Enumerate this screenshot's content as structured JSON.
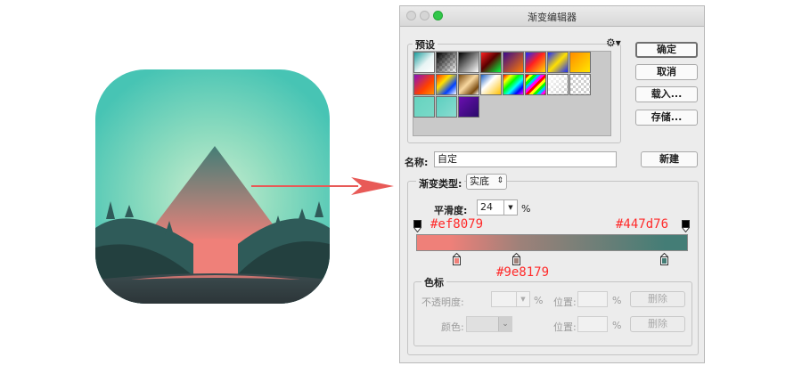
{
  "window": {
    "title": "渐变编辑器"
  },
  "presets": {
    "label": "预设",
    "menu_icon": "gear-icon"
  },
  "buttons": {
    "ok": "确定",
    "cancel": "取消",
    "load": "载入...",
    "save": "存储...",
    "new": "新建"
  },
  "name": {
    "label": "名称:",
    "value": "自定"
  },
  "gradient_type": {
    "label": "渐变类型:",
    "value": "实底"
  },
  "smoothness": {
    "label": "平滑度:",
    "value": "24",
    "unit": "%"
  },
  "annotations": {
    "left_color": "#ef8079",
    "right_color": "#447d76",
    "mid_color": "#9e8179"
  },
  "gradient": {
    "colors": [
      "#ef8079",
      "#9e8179",
      "#447d76"
    ]
  },
  "stops": {
    "label": "色标",
    "opacity_label": "不透明度:",
    "opacity_unit": "%",
    "position_label": "位置:",
    "position_unit": "%",
    "delete": "删除",
    "color_label": "颜色:",
    "position_label_2": "位置:",
    "position_unit_2": "%",
    "delete_2": "删除"
  }
}
